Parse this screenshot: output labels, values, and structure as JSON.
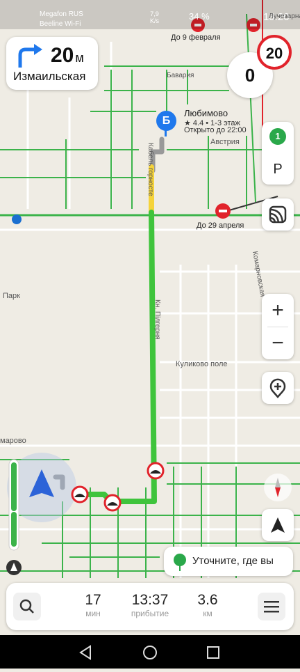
{
  "status_bar": {
    "carrier_1": "Megafon RUS",
    "carrier_2": "Beeline Wi-Fi",
    "net_speed": "7,9",
    "net_unit": "K/s",
    "battery": "34 %",
    "time": "13:20"
  },
  "maneuver": {
    "distance": "20",
    "unit": "м",
    "street": "Измаильская"
  },
  "speed": {
    "current": "0",
    "limit": "20"
  },
  "poi": {
    "marker_letter": "Б",
    "name": "Любимово",
    "rating": "★ 4.4 • 1-3 этаж",
    "hours": "Открыто до 22:00"
  },
  "map_labels": {
    "closure_1": "До 9 февраля",
    "closure_2": "До 29 апреля",
    "place_bavaria": "Бавария",
    "place_austria": "Австрия",
    "district": "Куликово поле",
    "park": "Парк",
    "street_left": "марово",
    "street_vertical": "Комарновская",
    "street_main": "Кн. Пілгерня",
    "street_upper": "Кабель горносте",
    "street_top": "Лучезарна"
  },
  "controls": {
    "traffic_level": "1",
    "parking": "P",
    "zoom_in": "+",
    "zoom_out": "−"
  },
  "location_hint": "Уточните, где вы",
  "trip": {
    "duration_value": "17",
    "duration_label": "мин",
    "arrival_value": "13:37",
    "arrival_label": "прибытие",
    "distance_value": "3.6",
    "distance_label": "км"
  },
  "colors": {
    "route": "#3fc43c",
    "route_yellow": "#f5d33a",
    "closure_red": "#e1232b",
    "poi_blue": "#1f78ec",
    "map_green_road": "#3bb34a"
  }
}
